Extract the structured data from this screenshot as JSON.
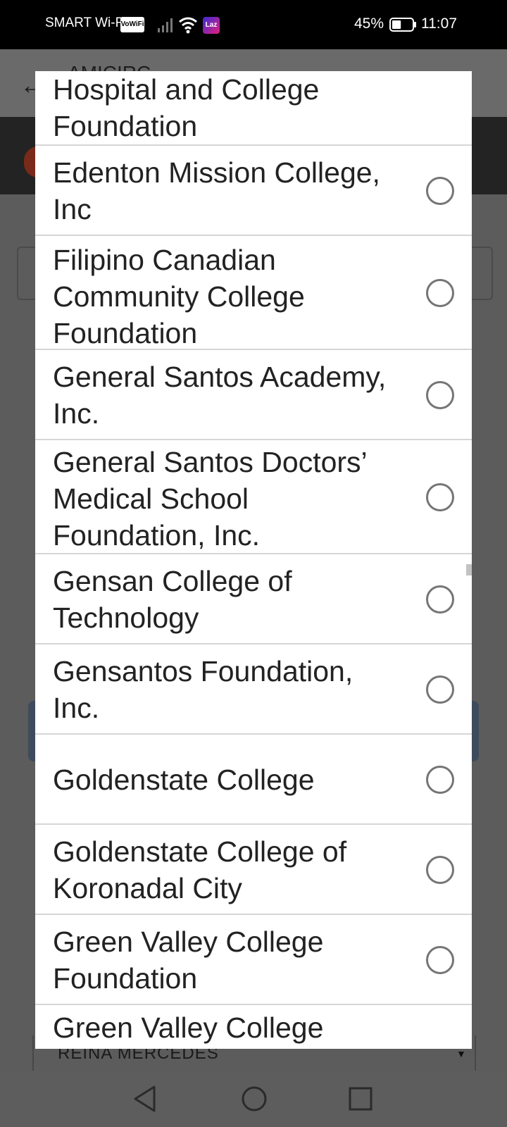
{
  "status_bar": {
    "carrier": "SMART Wi-Fi",
    "vowifi_badge": "VoWiFi",
    "laz_badge": "Laz",
    "battery_percent": "45%",
    "battery_level": 0.45,
    "time": "11:07"
  },
  "background_app": {
    "title": "AMICIRC",
    "back_icon": "arrow-left-icon",
    "select_value": "REINA MERCEDES"
  },
  "dialog": {
    "options": [
      {
        "label": "Hospital and College Foundation",
        "selected": false
      },
      {
        "label": "Edenton Mission College, Inc",
        "selected": false
      },
      {
        "label": "Filipino Canadian Community College Foundation",
        "selected": false
      },
      {
        "label": "General Santos Academy, Inc.",
        "selected": false
      },
      {
        "label": "General Santos Doctors’ Medical School Foundation, Inc.",
        "selected": false
      },
      {
        "label": "Gensan College of Technology",
        "selected": false
      },
      {
        "label": "Gensantos Foundation, Inc.",
        "selected": false
      },
      {
        "label": "Goldenstate College",
        "selected": false
      },
      {
        "label": "Goldenstate College of Koronadal City",
        "selected": false
      },
      {
        "label": "Green Valley College Foundation",
        "selected": false
      },
      {
        "label": "Green Valley College",
        "selected": false
      }
    ]
  },
  "nav_bar": {
    "back": "triangle-back-icon",
    "home": "circle-home-icon",
    "recents": "square-recents-icon"
  }
}
